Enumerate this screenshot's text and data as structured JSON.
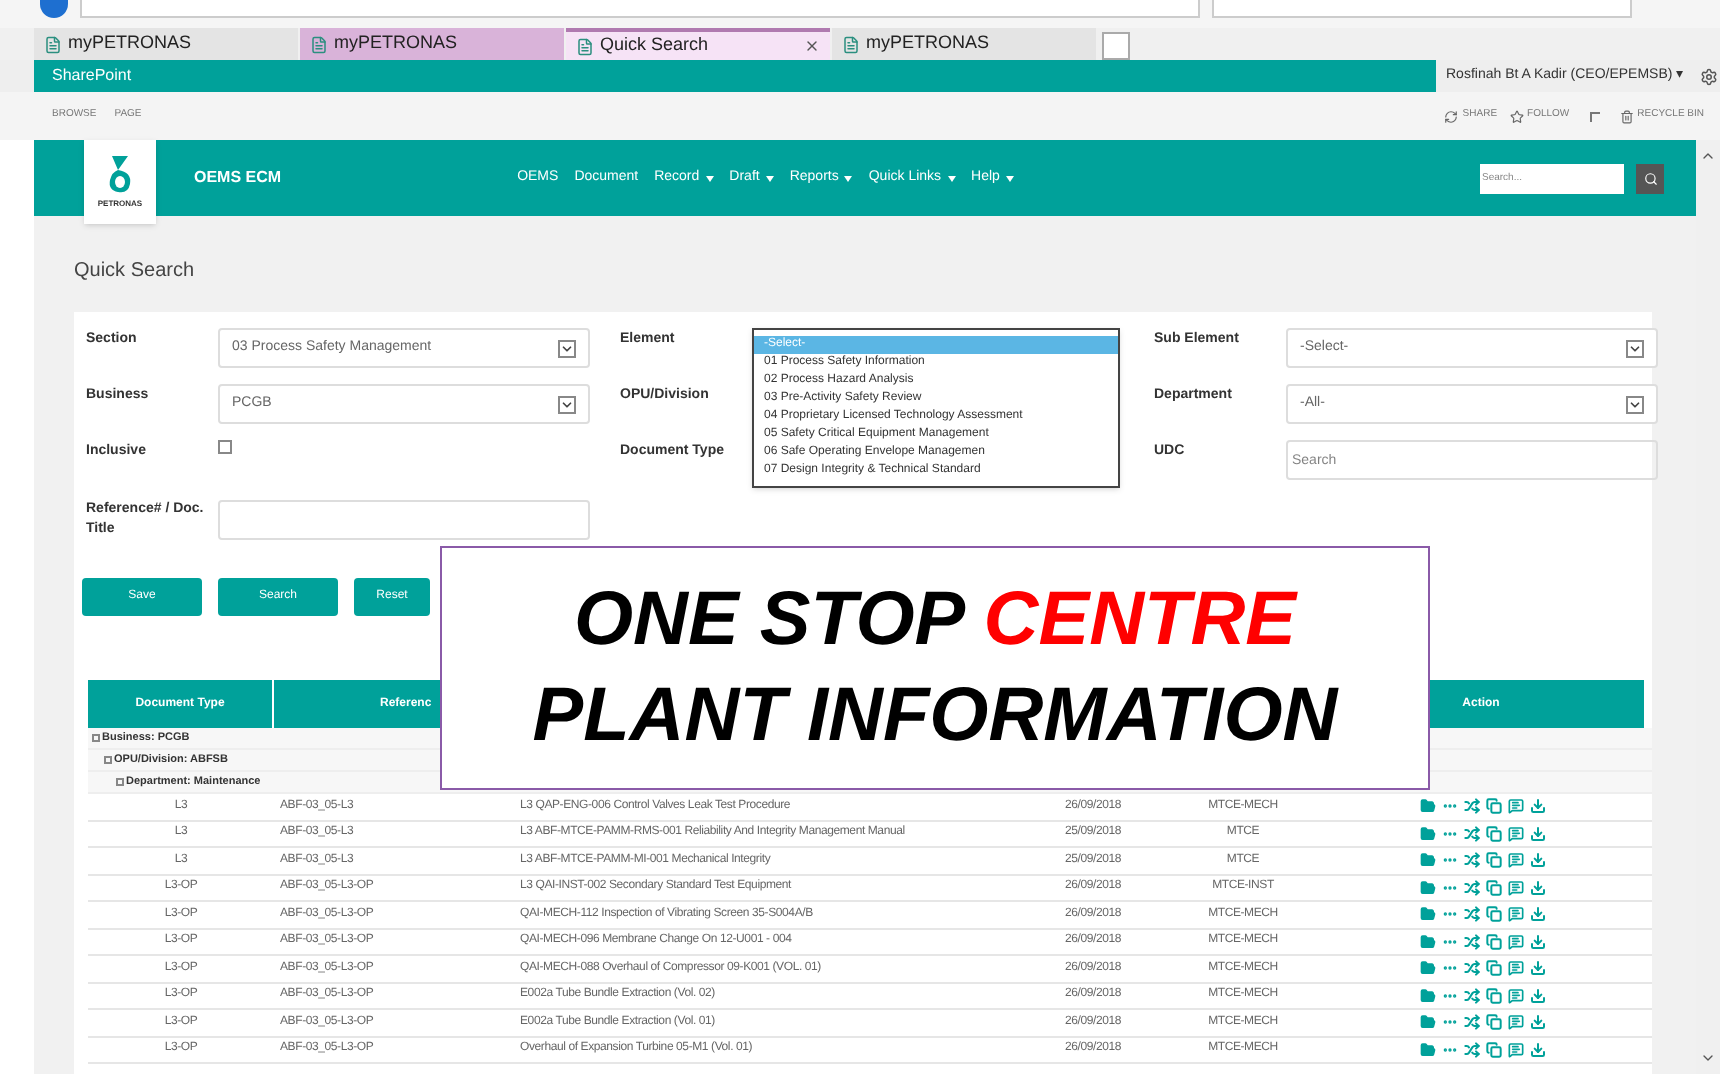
{
  "browser": {
    "tabs": [
      {
        "label": "myPETRONAS",
        "selected": false,
        "color": "#e4e4e4",
        "closable": false
      },
      {
        "label": "myPETRONAS",
        "selected": false,
        "color": "#d9b3d9",
        "closable": false
      },
      {
        "label": "Quick Search",
        "selected": true,
        "color": "#f6e3f6",
        "closable": true
      },
      {
        "label": "myPETRONAS",
        "selected": false,
        "color": "#e4e4e4",
        "closable": false
      }
    ]
  },
  "suite_bar": {
    "title": "SharePoint",
    "user": "Rosfinah Bt A Kadir (CEO/EPEMSB)",
    "user_caret": "▾"
  },
  "ribbon": {
    "left": [
      "BROWSE",
      "PAGE"
    ],
    "share": "SHARE",
    "follow": "FOLLOW",
    "recycle": "RECYCLE BIN"
  },
  "header": {
    "logo_text": "PETRONAS",
    "site_title": "OEMS ECM",
    "nav": [
      {
        "label": "OEMS",
        "dropdown": false
      },
      {
        "label": "Document",
        "dropdown": false
      },
      {
        "label": "Record",
        "dropdown": true
      },
      {
        "label": "Draft",
        "dropdown": true
      },
      {
        "label": "Reports",
        "dropdown": true
      },
      {
        "label": "Quick Links",
        "dropdown": true
      },
      {
        "label": "Help",
        "dropdown": true
      }
    ],
    "search": {
      "placeholder": "Search..."
    }
  },
  "page_title": "Quick Search",
  "form": {
    "section": {
      "label": "Section",
      "value": "03 Process Safety Management"
    },
    "business": {
      "label": "Business",
      "value": "PCGB"
    },
    "inclusive": {
      "label": "Inclusive",
      "checked": false
    },
    "reference": {
      "label": "Reference# / Doc. Title"
    },
    "element": {
      "label": "Element",
      "options": [
        {
          "label": "-Select-",
          "selected": true
        },
        {
          "label": "01 Process Safety Information",
          "selected": false
        },
        {
          "label": "02 Process Hazard Analysis",
          "selected": false
        },
        {
          "label": "03 Pre-Activity Safety Review",
          "selected": false
        },
        {
          "label": "04 Proprietary Licensed Technology Assessment",
          "selected": false
        },
        {
          "label": "05 Safety Critical Equipment Management",
          "selected": false
        },
        {
          "label": "06 Safe Operating Envelope Managemen",
          "selected": false
        },
        {
          "label": "07 Design Integrity  & Technical Standard",
          "selected": false
        }
      ]
    },
    "opu": {
      "label": "OPU/Division"
    },
    "document_type": {
      "label": "Document Type"
    },
    "sub_element": {
      "label": "Sub Element",
      "value": "-Select-"
    },
    "department": {
      "label": "Department",
      "value": "-All-"
    },
    "udc": {
      "label": "UDC",
      "placeholder": "Search"
    }
  },
  "buttons": [
    "Save",
    "Search",
    "Reset"
  ],
  "table": {
    "columns": [
      "Document Type",
      "Referenc",
      "Action"
    ],
    "groups": [
      "Business: PCGB",
      "OPU/Division: ABFSB",
      "Department: Maintenance"
    ],
    "rows": [
      [
        "L3",
        "ABF-03_05-L3",
        "L3 QAP-ENG-006 Control Valves Leak Test Procedure",
        "26/09/2018",
        "MTCE-MECH"
      ],
      [
        "L3",
        "ABF-03_05-L3",
        "L3 ABF-MTCE-PAMM-RMS-001 Reliability And Integrity Management Manual",
        "25/09/2018",
        "MTCE"
      ],
      [
        "L3",
        "ABF-03_05-L3",
        "L3 ABF-MTCE-PAMM-MI-001 Mechanical Integrity",
        "25/09/2018",
        "MTCE"
      ],
      [
        "L3-OP",
        "ABF-03_05-L3-OP",
        "L3 QAI-INST-002 Secondary Standard Test Equipment",
        "26/09/2018",
        "MTCE-INST"
      ],
      [
        "L3-OP",
        "ABF-03_05-L3-OP",
        "QAI-MECH-112 Inspection of Vibrating Screen 35-S004A/B",
        "26/09/2018",
        "MTCE-MECH"
      ],
      [
        "L3-OP",
        "ABF-03_05-L3-OP",
        "QAI-MECH-096 Membrane Change On 12-U001 - 004",
        "26/09/2018",
        "MTCE-MECH"
      ],
      [
        "L3-OP",
        "ABF-03_05-L3-OP",
        "QAI-MECH-088 Overhaul of Compressor 09-K001 (VOL. 01)",
        "26/09/2018",
        "MTCE-MECH"
      ],
      [
        "L3-OP",
        "ABF-03_05-L3-OP",
        "E002a Tube Bundle Extraction (Vol. 02)",
        "26/09/2018",
        "MTCE-MECH"
      ],
      [
        "L3-OP",
        "ABF-03_05-L3-OP",
        "E002a Tube Bundle Extraction (Vol. 01)",
        "26/09/2018",
        "MTCE-MECH"
      ],
      [
        "L3-OP",
        "ABF-03_05-L3-OP",
        "Overhaul of Expansion Turbine 05-M1 (Vol. 01)",
        "26/09/2018",
        "MTCE-MECH"
      ]
    ]
  },
  "overlay": {
    "lines": [
      [
        {
          "text": "ONE STOP",
          "color": "#000000"
        },
        {
          "text": "CENTRE",
          "color": "#ff0000"
        }
      ],
      [
        {
          "text": "PLANT INFORMATION",
          "color": "#000000"
        }
      ]
    ]
  }
}
